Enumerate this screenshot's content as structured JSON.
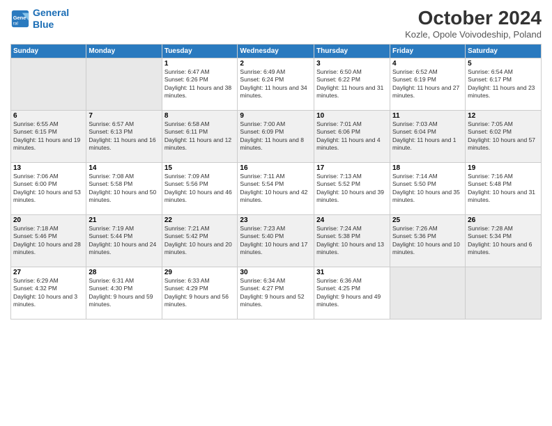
{
  "header": {
    "logo_line1": "General",
    "logo_line2": "Blue",
    "month": "October 2024",
    "location": "Kozle, Opole Voivodeship, Poland"
  },
  "days_of_week": [
    "Sunday",
    "Monday",
    "Tuesday",
    "Wednesday",
    "Thursday",
    "Friday",
    "Saturday"
  ],
  "weeks": [
    [
      {
        "num": "",
        "info": ""
      },
      {
        "num": "",
        "info": ""
      },
      {
        "num": "1",
        "info": "Sunrise: 6:47 AM\nSunset: 6:26 PM\nDaylight: 11 hours and 38 minutes."
      },
      {
        "num": "2",
        "info": "Sunrise: 6:49 AM\nSunset: 6:24 PM\nDaylight: 11 hours and 34 minutes."
      },
      {
        "num": "3",
        "info": "Sunrise: 6:50 AM\nSunset: 6:22 PM\nDaylight: 11 hours and 31 minutes."
      },
      {
        "num": "4",
        "info": "Sunrise: 6:52 AM\nSunset: 6:19 PM\nDaylight: 11 hours and 27 minutes."
      },
      {
        "num": "5",
        "info": "Sunrise: 6:54 AM\nSunset: 6:17 PM\nDaylight: 11 hours and 23 minutes."
      }
    ],
    [
      {
        "num": "6",
        "info": "Sunrise: 6:55 AM\nSunset: 6:15 PM\nDaylight: 11 hours and 19 minutes."
      },
      {
        "num": "7",
        "info": "Sunrise: 6:57 AM\nSunset: 6:13 PM\nDaylight: 11 hours and 16 minutes."
      },
      {
        "num": "8",
        "info": "Sunrise: 6:58 AM\nSunset: 6:11 PM\nDaylight: 11 hours and 12 minutes."
      },
      {
        "num": "9",
        "info": "Sunrise: 7:00 AM\nSunset: 6:09 PM\nDaylight: 11 hours and 8 minutes."
      },
      {
        "num": "10",
        "info": "Sunrise: 7:01 AM\nSunset: 6:06 PM\nDaylight: 11 hours and 4 minutes."
      },
      {
        "num": "11",
        "info": "Sunrise: 7:03 AM\nSunset: 6:04 PM\nDaylight: 11 hours and 1 minute."
      },
      {
        "num": "12",
        "info": "Sunrise: 7:05 AM\nSunset: 6:02 PM\nDaylight: 10 hours and 57 minutes."
      }
    ],
    [
      {
        "num": "13",
        "info": "Sunrise: 7:06 AM\nSunset: 6:00 PM\nDaylight: 10 hours and 53 minutes."
      },
      {
        "num": "14",
        "info": "Sunrise: 7:08 AM\nSunset: 5:58 PM\nDaylight: 10 hours and 50 minutes."
      },
      {
        "num": "15",
        "info": "Sunrise: 7:09 AM\nSunset: 5:56 PM\nDaylight: 10 hours and 46 minutes."
      },
      {
        "num": "16",
        "info": "Sunrise: 7:11 AM\nSunset: 5:54 PM\nDaylight: 10 hours and 42 minutes."
      },
      {
        "num": "17",
        "info": "Sunrise: 7:13 AM\nSunset: 5:52 PM\nDaylight: 10 hours and 39 minutes."
      },
      {
        "num": "18",
        "info": "Sunrise: 7:14 AM\nSunset: 5:50 PM\nDaylight: 10 hours and 35 minutes."
      },
      {
        "num": "19",
        "info": "Sunrise: 7:16 AM\nSunset: 5:48 PM\nDaylight: 10 hours and 31 minutes."
      }
    ],
    [
      {
        "num": "20",
        "info": "Sunrise: 7:18 AM\nSunset: 5:46 PM\nDaylight: 10 hours and 28 minutes."
      },
      {
        "num": "21",
        "info": "Sunrise: 7:19 AM\nSunset: 5:44 PM\nDaylight: 10 hours and 24 minutes."
      },
      {
        "num": "22",
        "info": "Sunrise: 7:21 AM\nSunset: 5:42 PM\nDaylight: 10 hours and 20 minutes."
      },
      {
        "num": "23",
        "info": "Sunrise: 7:23 AM\nSunset: 5:40 PM\nDaylight: 10 hours and 17 minutes."
      },
      {
        "num": "24",
        "info": "Sunrise: 7:24 AM\nSunset: 5:38 PM\nDaylight: 10 hours and 13 minutes."
      },
      {
        "num": "25",
        "info": "Sunrise: 7:26 AM\nSunset: 5:36 PM\nDaylight: 10 hours and 10 minutes."
      },
      {
        "num": "26",
        "info": "Sunrise: 7:28 AM\nSunset: 5:34 PM\nDaylight: 10 hours and 6 minutes."
      }
    ],
    [
      {
        "num": "27",
        "info": "Sunrise: 6:29 AM\nSunset: 4:32 PM\nDaylight: 10 hours and 3 minutes."
      },
      {
        "num": "28",
        "info": "Sunrise: 6:31 AM\nSunset: 4:30 PM\nDaylight: 9 hours and 59 minutes."
      },
      {
        "num": "29",
        "info": "Sunrise: 6:33 AM\nSunset: 4:29 PM\nDaylight: 9 hours and 56 minutes."
      },
      {
        "num": "30",
        "info": "Sunrise: 6:34 AM\nSunset: 4:27 PM\nDaylight: 9 hours and 52 minutes."
      },
      {
        "num": "31",
        "info": "Sunrise: 6:36 AM\nSunset: 4:25 PM\nDaylight: 9 hours and 49 minutes."
      },
      {
        "num": "",
        "info": ""
      },
      {
        "num": "",
        "info": ""
      }
    ]
  ]
}
